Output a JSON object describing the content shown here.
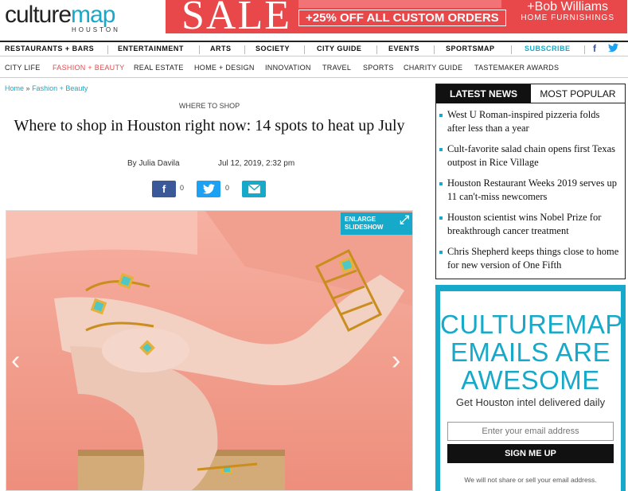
{
  "brand": {
    "logo_culture": "culture",
    "logo_map": "map",
    "city": "HOUSTON"
  },
  "ad": {
    "sale": "SALE",
    "offer": "+25% OFF ALL CUSTOM ORDERS",
    "brand_name": "+Bob Williams",
    "brand_tagline": "HOME FURNISHINGS"
  },
  "nav_primary": [
    "RESTAURANTS + BARS",
    "ENTERTAINMENT",
    "ARTS",
    "SOCIETY",
    "CITY GUIDE",
    "EVENTS",
    "SPORTSMAP",
    "SUBSCRIBE"
  ],
  "nav_secondary": [
    "CITY LIFE",
    "FASHION + BEAUTY",
    "REAL ESTATE",
    "HOME + DESIGN",
    "INNOVATION",
    "TRAVEL",
    "SPORTS",
    "CHARITY GUIDE",
    "TASTEMAKER AWARDS"
  ],
  "breadcrumb": {
    "home": "Home",
    "sep": "»",
    "section": "Fashion + Beauty"
  },
  "article": {
    "kicker": "WHERE TO SHOP",
    "title": "Where to shop in Houston right now: 14 spots to heat up July",
    "byline": "By Julia Davila",
    "date": "Jul 12, 2019, 2:32 pm",
    "facebook_count": "0",
    "twitter_count": "0"
  },
  "hero": {
    "enlarge_line1": "ENLARGE",
    "enlarge_line2": "SLIDESHOW"
  },
  "sidebar": {
    "tab_latest": "LATEST NEWS",
    "tab_popular": "MOST POPULAR",
    "news": [
      "West U Roman-inspired pizzeria folds after less than a year",
      "Cult-favorite salad chain opens first Texas outpost in Rice Village",
      "Houston Restaurant Weeks 2019 serves up 11 can't-miss newcomers",
      "Houston scientist wins Nobel Prize for breakthrough cancer treatment",
      "Chris Shepherd keeps things close to home for new version of One Fifth"
    ]
  },
  "newsletter": {
    "headline_1": "CULTUREMAP",
    "headline_2": "EMAILS ARE",
    "headline_3": "AWESOME",
    "subhead": "Get Houston intel delivered daily",
    "placeholder": "Enter your email address",
    "button": "SIGN ME UP",
    "note": "We will not share or sell your email address."
  },
  "colors": {
    "accent": "#17a9c9",
    "sale_red": "#e9484a",
    "facebook": "#3b5998",
    "twitter": "#1da1f2"
  }
}
